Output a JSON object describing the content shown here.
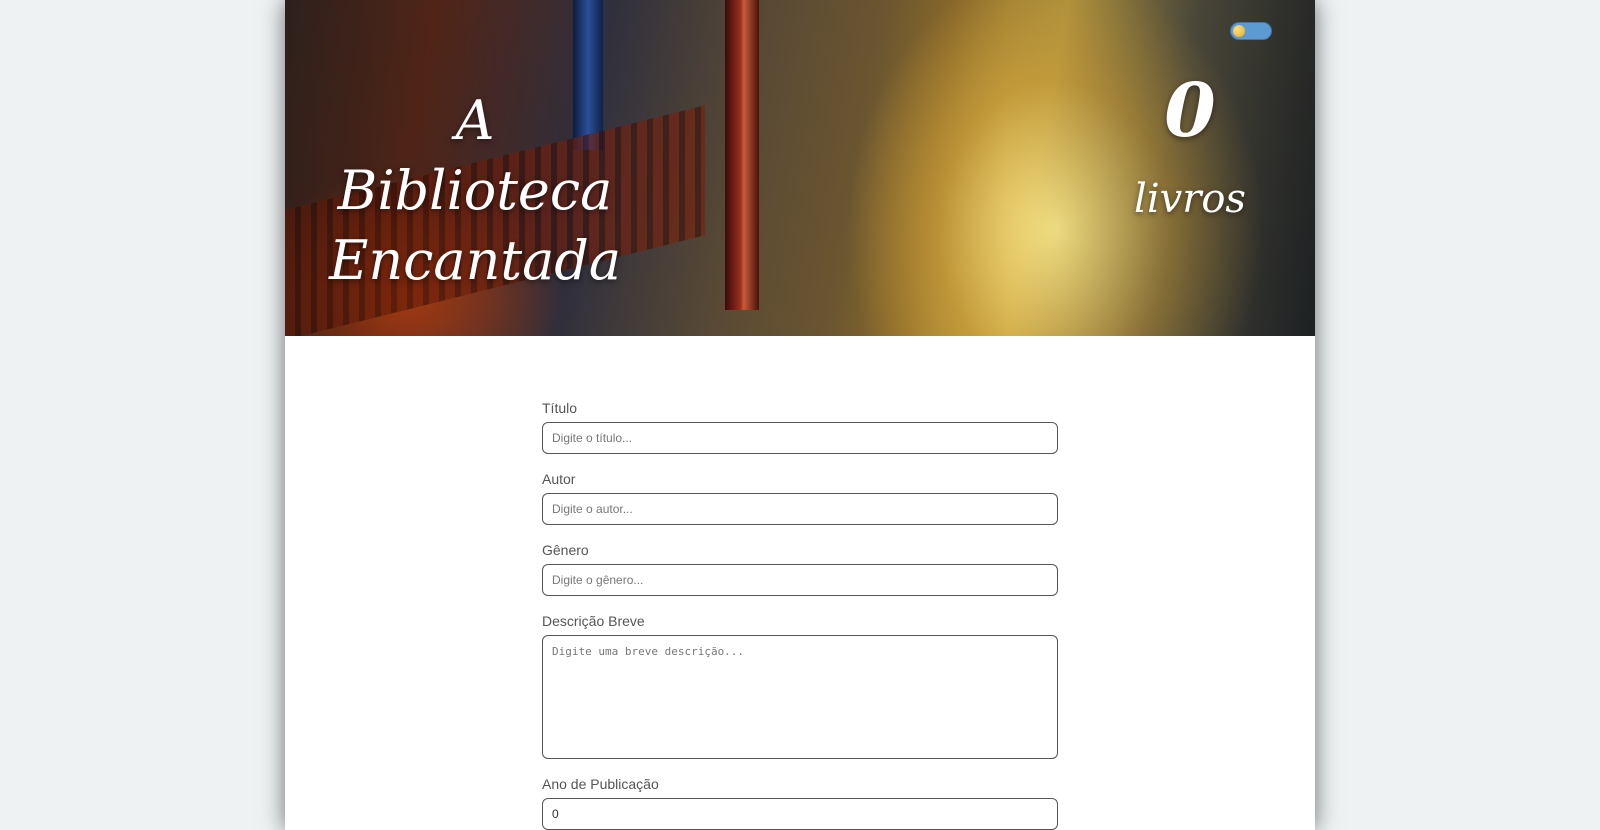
{
  "header": {
    "title_line1": "A Biblioteca",
    "title_line2": "Encantada",
    "book_count": "0",
    "book_count_label": "livros",
    "theme_toggle": {
      "state": "off"
    }
  },
  "form": {
    "titulo": {
      "label": "Título",
      "placeholder": "Digite o título..."
    },
    "autor": {
      "label": "Autor",
      "placeholder": "Digite o autor..."
    },
    "genero": {
      "label": "Gênero",
      "placeholder": "Digite o gênero..."
    },
    "descricao": {
      "label": "Descrição Breve",
      "placeholder": "Digite uma breve descrição..."
    },
    "ano": {
      "label": "Ano de Publicação",
      "value": "0"
    }
  },
  "colors": {
    "toggle_track": "#5b9bd1",
    "toggle_knob": "#e4a92a",
    "page_background": "#eef2f3"
  },
  "icons": {
    "toggle_knob": "sun-icon"
  }
}
